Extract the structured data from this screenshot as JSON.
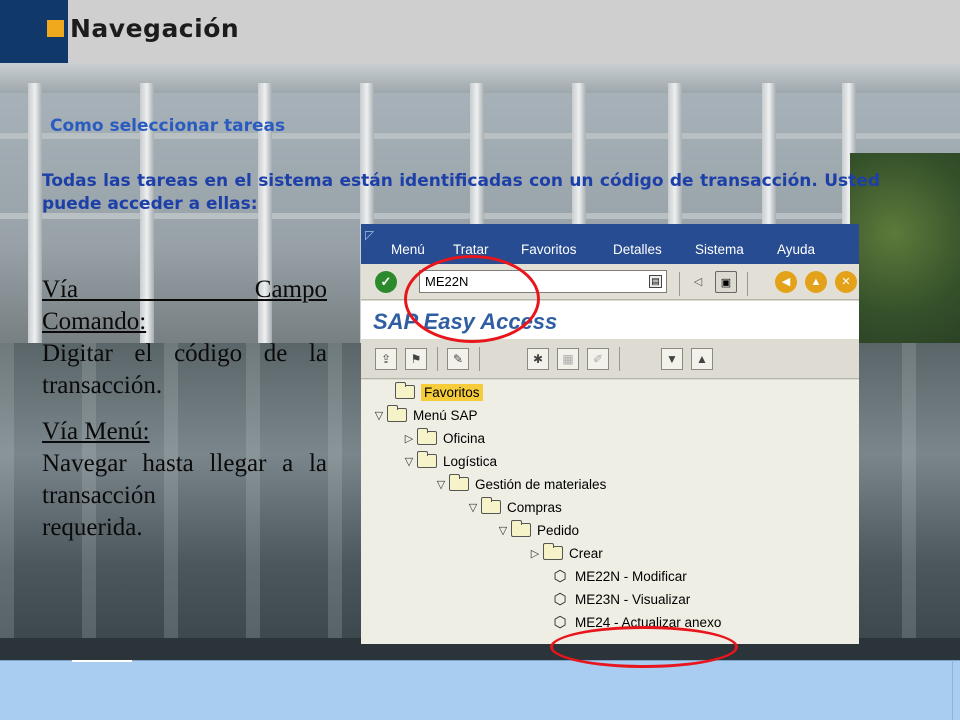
{
  "header": {
    "title": "Navegación"
  },
  "subtitle": "Como seleccionar tareas",
  "paragraph": "Todas las tareas en el sistema están identificadas con un código de transacción.  Usted puede acceder a ellas:",
  "left": {
    "via_campo_1": "Vía",
    "via_campo_2": "Campo",
    "comando": "Comando:",
    "digitar": "Digitar el código de la transacción.",
    "via_menu": "Vía Menú:",
    "navegar": "Navegar hasta llegar a la transacción",
    "requerida": "requerida."
  },
  "sap": {
    "menu": [
      "Menú",
      "Tratar",
      "Favoritos",
      "Detalles",
      "Sistema",
      "Ayuda"
    ],
    "command_value": "ME22N",
    "title": "SAP Easy Access",
    "tree": {
      "favoritos": "Favoritos",
      "menu_sap": "Menú SAP",
      "oficina": "Oficina",
      "logistica": "Logística",
      "gestion": "Gestión de materiales",
      "compras": "Compras",
      "pedido": "Pedido",
      "crear": "Crear",
      "me22n": "ME22N - Modificar",
      "me23n": "ME23N - Visualizar",
      "me24": "ME24 - Actualizar anexo"
    }
  },
  "icons": [
    "check-icon",
    "history-icon",
    "back-icon",
    "save-icon",
    "nav-back-icon",
    "nav-exit-icon",
    "cancel-icon",
    "folder-icon",
    "transaction-icon",
    "arrow-right-icon",
    "arrow-down-icon"
  ],
  "colors": {
    "header_block": "#10386a",
    "accent": "#f0a81c",
    "sap_menu": "#274c91",
    "ring": "#e8161c",
    "footer": "#a9cdf0"
  }
}
